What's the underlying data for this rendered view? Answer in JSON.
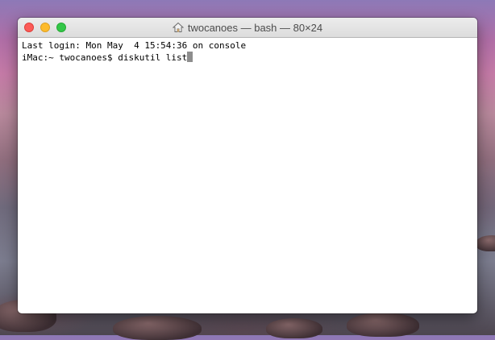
{
  "window": {
    "title": "twocanoes — bash — 80×24",
    "title_icon": "home-icon"
  },
  "terminal": {
    "lines": [
      "Last login: Mon May  4 15:54:36 on console",
      "iMac:~ twocanoes$ diskutil list"
    ]
  },
  "colors": {
    "close": "#fc5b57",
    "minimize": "#fdbb2d",
    "zoom": "#33c748",
    "cursor": "#8e8e8e"
  }
}
